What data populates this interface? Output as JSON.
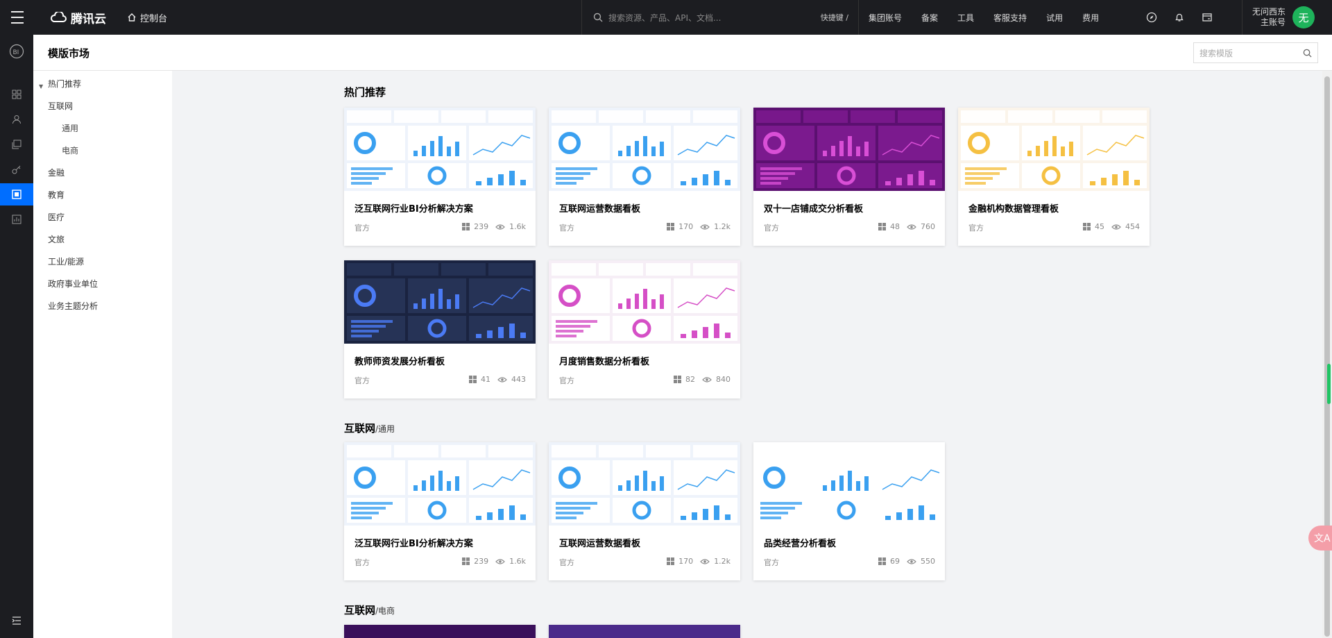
{
  "topbar": {
    "brand": "腾讯云",
    "console": "控制台",
    "search_placeholder": "搜索资源、产品、API、文档...",
    "shortcut": "快捷键 /",
    "links": [
      "集团账号",
      "备案",
      "工具",
      "客服支持",
      "试用",
      "费用"
    ],
    "account_line1": "无问西东",
    "account_line2": "主账号",
    "avatar_text": "无",
    "avatar_color": "#1eb35b"
  },
  "page": {
    "title": "模版市场",
    "search_placeholder": "搜索模版"
  },
  "categories": [
    {
      "label": "热门推荐"
    },
    {
      "label": "互联网"
    },
    {
      "label": "通用"
    },
    {
      "label": "电商"
    },
    {
      "label": "金融"
    },
    {
      "label": "教育"
    },
    {
      "label": "医疗"
    },
    {
      "label": "文旅"
    },
    {
      "label": "工业/能源"
    },
    {
      "label": "政府事业单位"
    },
    {
      "label": "业务主题分析"
    }
  ],
  "sections": [
    {
      "title": "热门推荐",
      "subtitle": ""
    },
    {
      "title": "互联网",
      "subtitle": "/通用"
    },
    {
      "title": "互联网",
      "subtitle": "/电商"
    }
  ],
  "cards": [
    {
      "title": "泛互联网行业BI分析解决方案",
      "source": "官方",
      "pages": "239",
      "views": "1.6k",
      "theme": "light"
    },
    {
      "title": "互联网运营数据看板",
      "source": "官方",
      "pages": "170",
      "views": "1.2k",
      "theme": "light"
    },
    {
      "title": "双十一店铺成交分析看板",
      "source": "官方",
      "pages": "48",
      "views": "760",
      "theme": "purple"
    },
    {
      "title": "金融机构数据管理看板",
      "source": "官方",
      "pages": "45",
      "views": "454",
      "theme": "cream"
    },
    {
      "title": "教师师资发展分析看板",
      "source": "官方",
      "pages": "41",
      "views": "443",
      "theme": "navy"
    },
    {
      "title": "月度销售数据分析看板",
      "source": "官方",
      "pages": "82",
      "views": "840",
      "theme": "pink"
    },
    {
      "title": "泛互联网行业BI分析解决方案",
      "source": "官方",
      "pages": "239",
      "views": "1.6k",
      "theme": "light"
    },
    {
      "title": "互联网运营数据看板",
      "source": "官方",
      "pages": "170",
      "views": "1.2k",
      "theme": "light"
    },
    {
      "title": "品类经营分析看板",
      "source": "官方",
      "pages": "69",
      "views": "550",
      "theme": "table"
    }
  ],
  "colors": {
    "topbar_bg": "#1c1d21",
    "active_rail": "#006eff",
    "accent_blue": "#2f5bea",
    "purple": "#5b1070",
    "navy": "#1a2340"
  }
}
